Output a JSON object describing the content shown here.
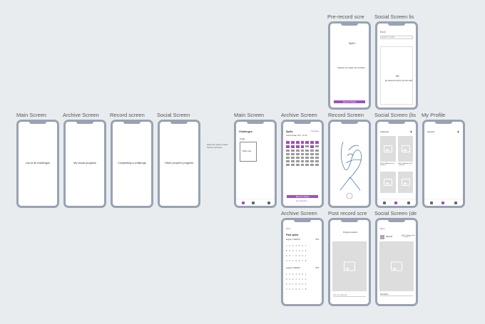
{
  "labels": {
    "pre_record": "Pre-record scre",
    "social_list_top": "Social Screen lis",
    "main1": "Main Screen",
    "archive1": "Archive Screen",
    "record1": "Record screen",
    "social1": "Social Screen",
    "main2": "Main Screen",
    "archive2": "Archive Screen",
    "record2": "Record Screen",
    "social2": "Social Screen (lis",
    "profile": "My Profile",
    "archive3": "Archive Screen",
    "post_record": "Post record scre",
    "social_item": "Social Screen (de"
  },
  "annotation": "Show two types of write\nScreen elements",
  "wire": {
    "main": "List of all challenges",
    "archive": "My visual progress",
    "record": "Completing a challenge",
    "social": "Other people's progress"
  },
  "main_screen": {
    "title": "Challenges",
    "section": "Today",
    "card_label": "Sticky note"
  },
  "archive_screen": {
    "title": "Splits",
    "subtitle": "Consistent",
    "caption": "Current streak: Oct 1 - on 30",
    "cta": "Record Today",
    "link": "See full archive"
  },
  "pre_record": {
    "line1": "Split 1",
    "line2": "Capture an image from position",
    "cta": "Record Today"
  },
  "social_list": {
    "header": "Back",
    "search": "Search for splits",
    "empty_title": "No",
    "empty_body": "get started & submit your first split!"
  },
  "social_screen": {
    "header": "Following",
    "card1": "Splits Challenge Day 2 · session 3",
    "card2": "Splits Challenge Day 2 · session 3"
  },
  "profile": {
    "title": "Security"
  },
  "archive3": {
    "header": "Back",
    "title": "Past splits",
    "month1": "August 1, 2020(1/7)",
    "month1_count": "8/15",
    "month2": "August 2, 2020(2/7)",
    "month2_count": "8/15"
  },
  "post_record": {
    "header": "Progress session",
    "input": "Add note (optional)"
  },
  "social_detail": {
    "header": "Back",
    "user": "Raywell",
    "meta": "Splits Challenge Day 2 · session 3",
    "caption": "Description"
  },
  "colors": {
    "accent": "#a14ec0",
    "frame": "#98a2b3",
    "background": "#e9ecef"
  }
}
